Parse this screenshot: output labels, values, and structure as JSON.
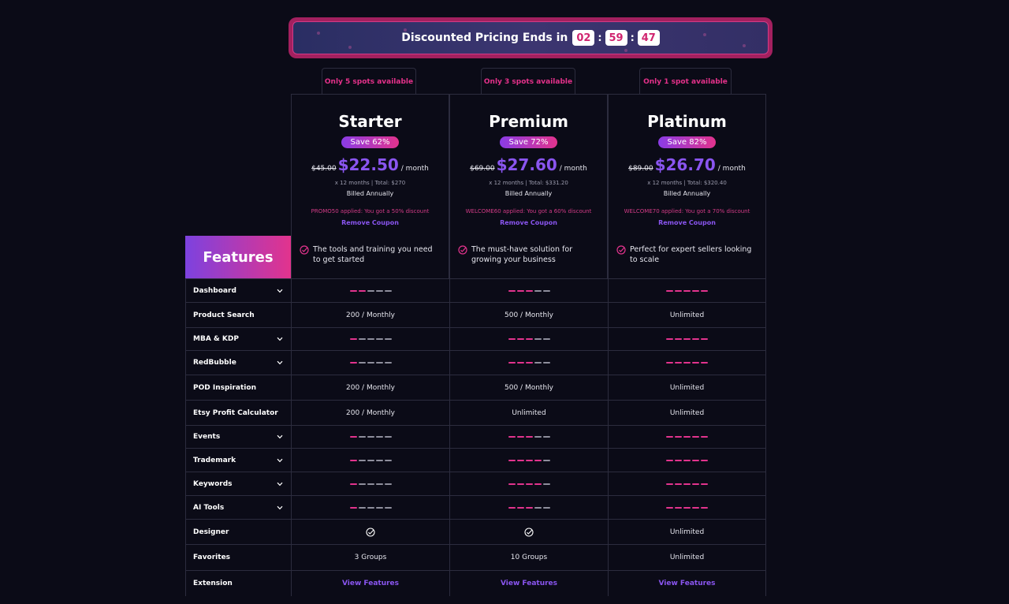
{
  "banner": {
    "text": "Discounted Pricing Ends in",
    "hours": "02",
    "minutes": "59",
    "seconds": "47"
  },
  "plans": [
    {
      "spots": "Only 5 spots available",
      "name": "Starter",
      "save": "Save 62%",
      "old_price": "$45.00",
      "price": "$22.50",
      "per": "/ month",
      "totals": "x 12 months | Total: $270",
      "billed": "Billed Annually",
      "promo": "PROMO50 applied: You got a 50% discount",
      "remove": "Remove Coupon",
      "description": "The tools and training you need to get started"
    },
    {
      "spots": "Only 3 spots available",
      "name": "Premium",
      "save": "Save 72%",
      "old_price": "$69.00",
      "price": "$27.60",
      "per": "/ month",
      "totals": "x 12 months | Total: $331.20",
      "billed": "Billed Annually",
      "promo": "WELCOME60 applied: You got a 60% discount",
      "remove": "Remove Coupon",
      "description": "The must-have solution for growing your business"
    },
    {
      "spots": "Only 1 spot available",
      "name": "Platinum",
      "save": "Save 82%",
      "old_price": "$89.00",
      "price": "$26.70",
      "per": "/ month",
      "totals": "x 12 months | Total: $320.40",
      "billed": "Billed Annually",
      "promo": "WELCOME70 applied: You got a 70% discount",
      "remove": "Remove Coupon",
      "description": "Perfect for expert sellers looking to scale"
    }
  ],
  "features_title": "Features",
  "features": [
    {
      "name": "Dashboard",
      "expandable": true,
      "values": [
        {
          "bars": 2
        },
        {
          "bars": 3
        },
        {
          "bars": 5
        }
      ]
    },
    {
      "name": "Product Search",
      "expandable": false,
      "values": [
        {
          "text": "200 / Monthly"
        },
        {
          "text": "500 / Monthly"
        },
        {
          "text": "Unlimited"
        }
      ]
    },
    {
      "name": "MBA & KDP",
      "expandable": true,
      "values": [
        {
          "bars": 1
        },
        {
          "bars": 3
        },
        {
          "bars": 5
        }
      ]
    },
    {
      "name": "RedBubble",
      "expandable": true,
      "values": [
        {
          "bars": 1
        },
        {
          "bars": 3
        },
        {
          "bars": 5
        }
      ]
    },
    {
      "name": "POD Inspiration",
      "expandable": false,
      "values": [
        {
          "text": "200 / Monthly"
        },
        {
          "text": "500 / Monthly"
        },
        {
          "text": "Unlimited"
        }
      ]
    },
    {
      "name": "Etsy Profit Calculator",
      "expandable": false,
      "values": [
        {
          "text": "200 / Monthly"
        },
        {
          "text": "Unlimited"
        },
        {
          "text": "Unlimited"
        }
      ]
    },
    {
      "name": "Events",
      "expandable": true,
      "values": [
        {
          "bars": 1
        },
        {
          "bars": 3
        },
        {
          "bars": 5
        }
      ]
    },
    {
      "name": "Trademark",
      "expandable": true,
      "values": [
        {
          "bars": 1
        },
        {
          "bars": 4
        },
        {
          "bars": 5
        }
      ]
    },
    {
      "name": "Keywords",
      "expandable": true,
      "values": [
        {
          "bars": 1
        },
        {
          "bars": 4
        },
        {
          "bars": 5
        }
      ]
    },
    {
      "name": "AI Tools",
      "expandable": true,
      "values": [
        {
          "bars": 1
        },
        {
          "bars": 3
        },
        {
          "bars": 5
        }
      ]
    },
    {
      "name": "Designer",
      "expandable": false,
      "values": [
        {
          "check": true
        },
        {
          "check": true
        },
        {
          "text": "Unlimited"
        }
      ]
    },
    {
      "name": "Favorites",
      "expandable": false,
      "values": [
        {
          "text": "3 Groups"
        },
        {
          "text": "10 Groups"
        },
        {
          "text": "Unlimited"
        }
      ]
    },
    {
      "name": "Extension",
      "expandable": false,
      "values": [
        {
          "link": "View Features"
        },
        {
          "link": "View Features"
        },
        {
          "link": "View Features"
        }
      ]
    }
  ],
  "colors": {
    "background": "#0b0b17",
    "accent_pink": "#e2338d",
    "accent_purple": "#8a55f0",
    "border": "#2c2c3e"
  }
}
